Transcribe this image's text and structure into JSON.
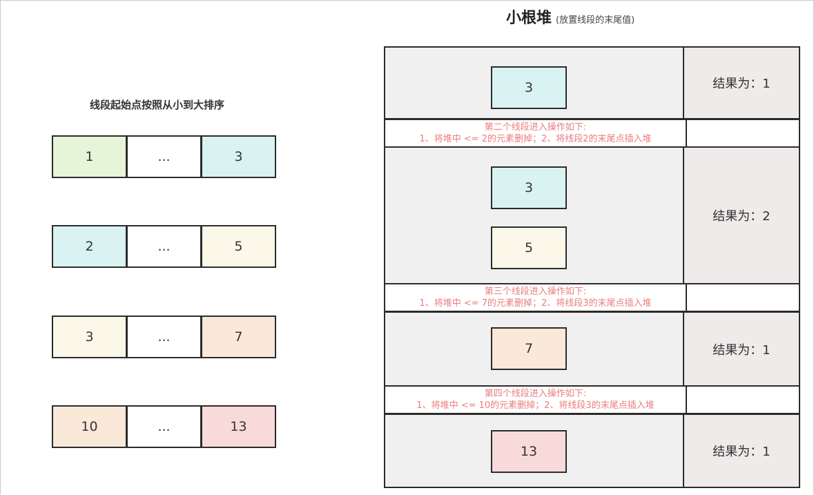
{
  "left": {
    "title": "线段起始点按照从小到大排序",
    "segments": [
      {
        "start": "1",
        "middle": "...",
        "end": "3",
        "start_color": "#e6f5d8",
        "end_color": "#d9f3f3"
      },
      {
        "start": "2",
        "middle": "...",
        "end": "5",
        "start_color": "#d9f3f3",
        "end_color": "#fbf8e9"
      },
      {
        "start": "3",
        "middle": "...",
        "end": "7",
        "start_color": "#fbf8e9",
        "end_color": "#fae8d9"
      },
      {
        "start": "10",
        "middle": "...",
        "end": "13",
        "start_color": "#fae8d9",
        "end_color": "#f8dada"
      }
    ]
  },
  "right": {
    "title": "小根堆",
    "subtitle": "(放置线段的末尾值)",
    "steps": [
      {
        "nodes": [
          "3"
        ],
        "result": "结果为：1"
      },
      {
        "note_line1": "第二个线段进入操作如下:",
        "note_line2": "1、将堆中 <= 2的元素删掉；2、将线段2的末尾点插入堆",
        "nodes": [
          "3",
          "5"
        ],
        "result": "结果为：2"
      },
      {
        "note_line1": "第三个线段进入操作如下:",
        "note_line2": "1、将堆中 <= 7的元素删掉；2、将线段3的末尾点插入堆",
        "nodes": [
          "7"
        ],
        "result": "结果为：1"
      },
      {
        "note_line1": "第四个线段进入操作如下:",
        "note_line2": "1、将堆中 <= 10的元素删掉；2、将线段3的末尾点插入堆",
        "nodes": [
          "13"
        ],
        "result": "结果为：1"
      }
    ]
  },
  "colors": {
    "accent_text": "#ea7d7d",
    "border": "#2b2b2b",
    "band_bg": "#f0f0f0",
    "result_bg": "#efebea"
  }
}
